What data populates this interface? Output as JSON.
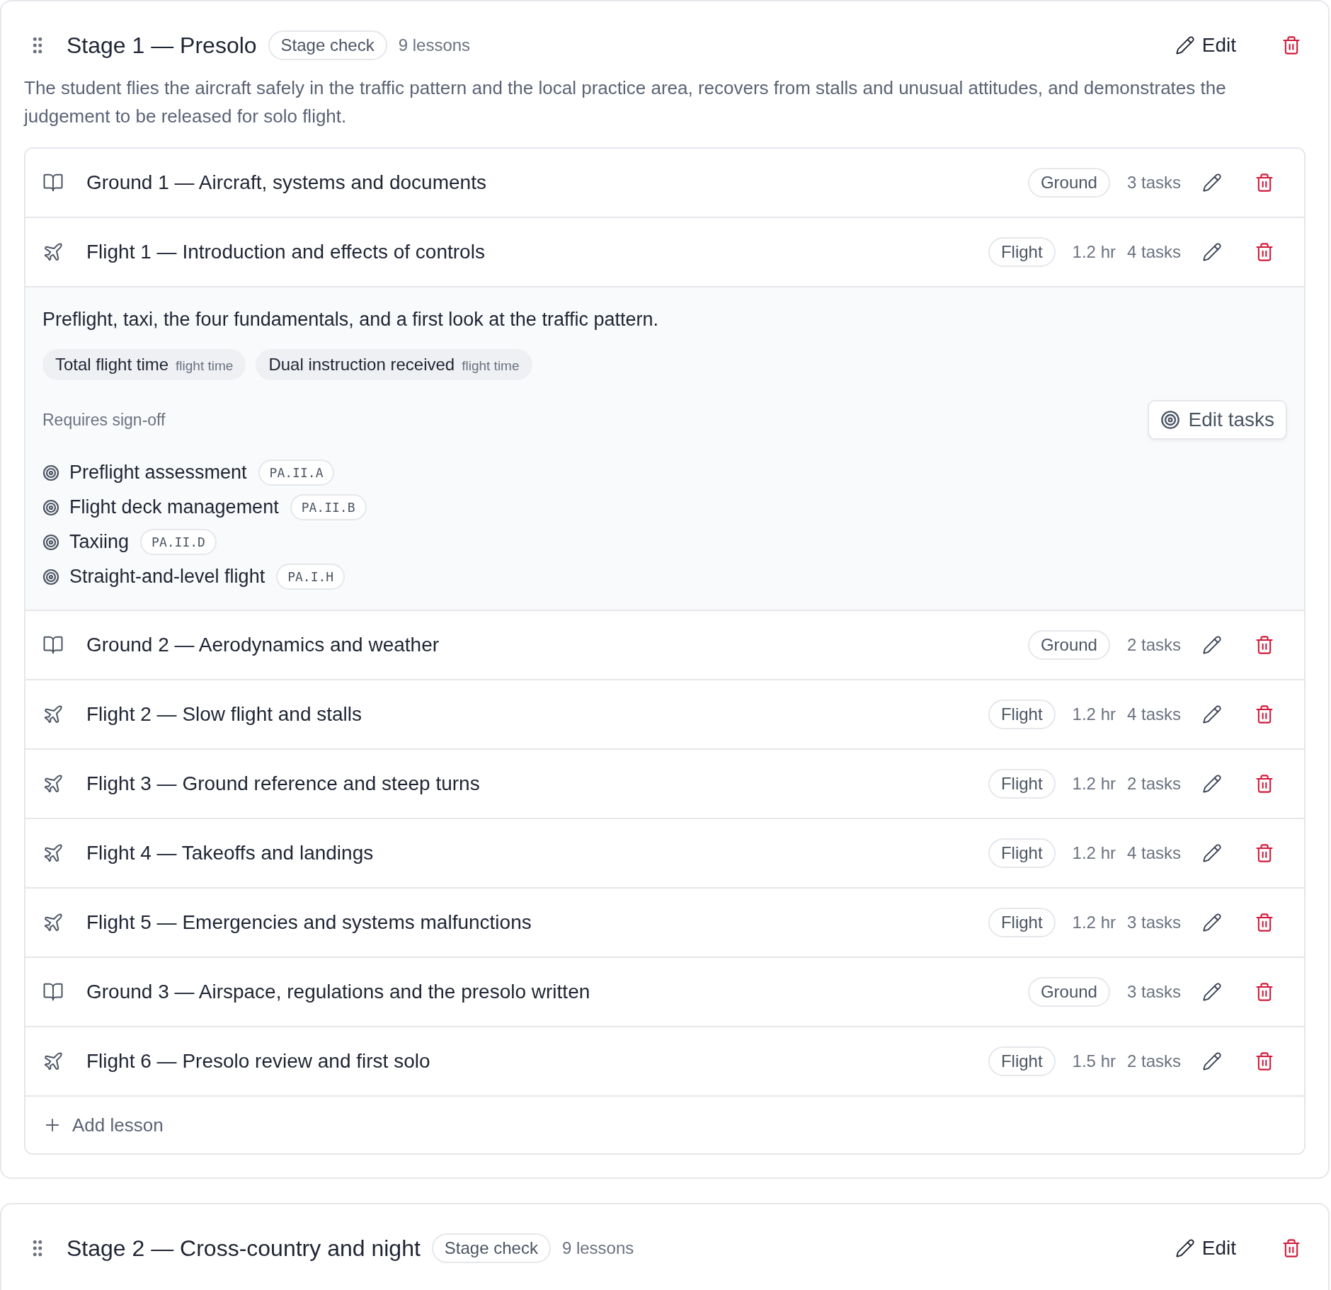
{
  "stages": [
    {
      "title": "Stage 1 — Presolo",
      "badge": "Stage check",
      "count": "9 lessons",
      "edit": "Edit",
      "description": "The student flies the aircraft safely in the traffic pattern and the local practice area, recovers from stalls and unusual attitudes, and demonstrates the judgement to be released for solo flight.",
      "add_label": "Add lesson",
      "lessons": [
        {
          "kind": "ground",
          "title": "Ground 1 — Aircraft, systems and documents",
          "badge": "Ground",
          "tasks": "3 tasks"
        },
        {
          "kind": "flight",
          "title": "Flight 1 — Introduction and effects of controls",
          "badge": "Flight",
          "hours": "1.2 hr",
          "tasks": "4 tasks",
          "details": {
            "summary": "Preflight, taxi, the four fundamentals, and a first look at the traffic pattern.",
            "tags": [
              {
                "label": "Total flight time",
                "type": "flight time"
              },
              {
                "label": "Dual instruction received",
                "type": "flight time"
              }
            ],
            "signoff_label": "Requires sign-off",
            "edit_tasks": "Edit tasks",
            "tasks": [
              {
                "name": "Preflight assessment",
                "code": "PA.II.A"
              },
              {
                "name": "Flight deck management",
                "code": "PA.II.B"
              },
              {
                "name": "Taxiing",
                "code": "PA.II.D"
              },
              {
                "name": "Straight-and-level flight",
                "code": "PA.I.H"
              }
            ]
          }
        },
        {
          "kind": "ground",
          "title": "Ground 2 — Aerodynamics and weather",
          "badge": "Ground",
          "tasks": "2 tasks"
        },
        {
          "kind": "flight",
          "title": "Flight 2 — Slow flight and stalls",
          "badge": "Flight",
          "hours": "1.2 hr",
          "tasks": "4 tasks"
        },
        {
          "kind": "flight",
          "title": "Flight 3 — Ground reference and steep turns",
          "badge": "Flight",
          "hours": "1.2 hr",
          "tasks": "2 tasks"
        },
        {
          "kind": "flight",
          "title": "Flight 4 — Takeoffs and landings",
          "badge": "Flight",
          "hours": "1.2 hr",
          "tasks": "4 tasks"
        },
        {
          "kind": "flight",
          "title": "Flight 5 — Emergencies and systems malfunctions",
          "badge": "Flight",
          "hours": "1.2 hr",
          "tasks": "3 tasks"
        },
        {
          "kind": "ground",
          "title": "Ground 3 — Airspace, regulations and the presolo written",
          "badge": "Ground",
          "tasks": "3 tasks"
        },
        {
          "kind": "flight",
          "title": "Flight 6 — Presolo review and first solo",
          "badge": "Flight",
          "hours": "1.5 hr",
          "tasks": "2 tasks"
        }
      ]
    },
    {
      "title": "Stage 2 — Cross-country and night",
      "badge": "Stage check",
      "count": "9 lessons",
      "edit": "Edit"
    }
  ]
}
